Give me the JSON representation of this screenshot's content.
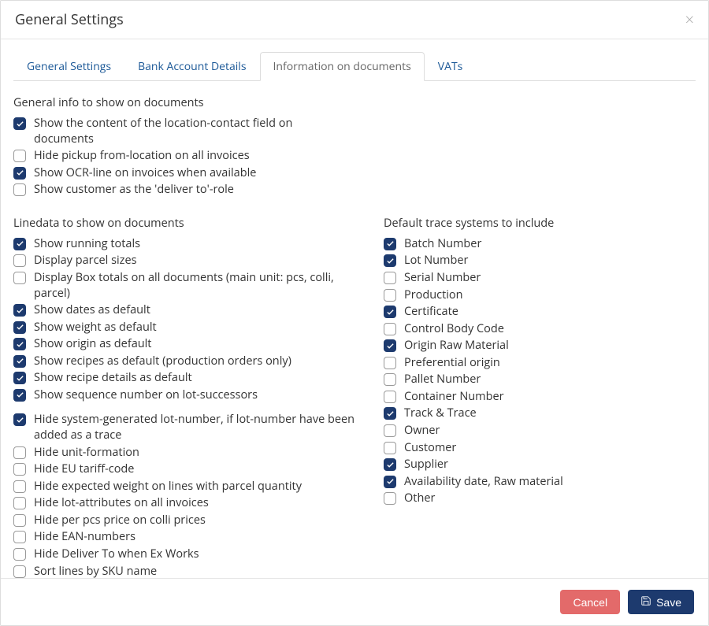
{
  "modal": {
    "title": "General Settings",
    "close": "×"
  },
  "tabs": [
    {
      "label": "General Settings",
      "active": false
    },
    {
      "label": "Bank Account Details",
      "active": false
    },
    {
      "label": "Information on documents",
      "active": true
    },
    {
      "label": "VATs",
      "active": false
    }
  ],
  "sections": {
    "general": {
      "title": "General info to show on documents",
      "items": [
        {
          "label": "Show the content of the location-contact field on documents",
          "checked": true
        },
        {
          "label": "Hide pickup from-location on all invoices",
          "checked": false
        },
        {
          "label": "Show OCR-line on invoices when available",
          "checked": true
        },
        {
          "label": "Show customer as the 'deliver to'-role",
          "checked": false
        }
      ]
    },
    "linedata": {
      "title": "Linedata to show on documents",
      "items": [
        {
          "label": "Show running totals",
          "checked": true
        },
        {
          "label": "Display parcel sizes",
          "checked": false
        },
        {
          "label": "Display Box totals on all documents (main unit: pcs, colli, parcel)",
          "checked": false
        },
        {
          "label": "Show dates as default",
          "checked": true
        },
        {
          "label": "Show weight as default",
          "checked": true
        },
        {
          "label": "Show origin as default",
          "checked": true
        },
        {
          "label": "Show recipes as default (production orders only)",
          "checked": true
        },
        {
          "label": "Show recipe details as default",
          "checked": true
        },
        {
          "label": "Show sequence number on lot-successors",
          "checked": true
        },
        {
          "label": "Hide system-generated lot-number, if lot-number have been added as a trace",
          "checked": true,
          "gap": true
        },
        {
          "label": "Hide unit-formation",
          "checked": false
        },
        {
          "label": "Hide EU tariff-code",
          "checked": false
        },
        {
          "label": "Hide expected weight on lines with parcel quantity",
          "checked": false
        },
        {
          "label": "Hide lot-attributes on all invoices",
          "checked": false
        },
        {
          "label": "Hide per pcs price on colli prices",
          "checked": false
        },
        {
          "label": "Hide EAN-numbers",
          "checked": false
        },
        {
          "label": "Hide Deliver To when Ex Works",
          "checked": false
        },
        {
          "label": "Sort lines by SKU name",
          "checked": false
        }
      ]
    },
    "trace": {
      "title": "Default trace systems to include",
      "items": [
        {
          "label": "Batch Number",
          "checked": true
        },
        {
          "label": "Lot Number",
          "checked": true
        },
        {
          "label": "Serial Number",
          "checked": false
        },
        {
          "label": "Production",
          "checked": false
        },
        {
          "label": "Certificate",
          "checked": true
        },
        {
          "label": "Control Body Code",
          "checked": false
        },
        {
          "label": "Origin Raw Material",
          "checked": true
        },
        {
          "label": "Preferential origin",
          "checked": false
        },
        {
          "label": "Pallet Number",
          "checked": false
        },
        {
          "label": "Container Number",
          "checked": false
        },
        {
          "label": "Track & Trace",
          "checked": true
        },
        {
          "label": "Owner",
          "checked": false
        },
        {
          "label": "Customer",
          "checked": false
        },
        {
          "label": "Supplier",
          "checked": true
        },
        {
          "label": "Availability date, Raw material",
          "checked": true
        },
        {
          "label": "Other",
          "checked": false
        }
      ]
    }
  },
  "footer": {
    "cancel": "Cancel",
    "save": "Save"
  }
}
